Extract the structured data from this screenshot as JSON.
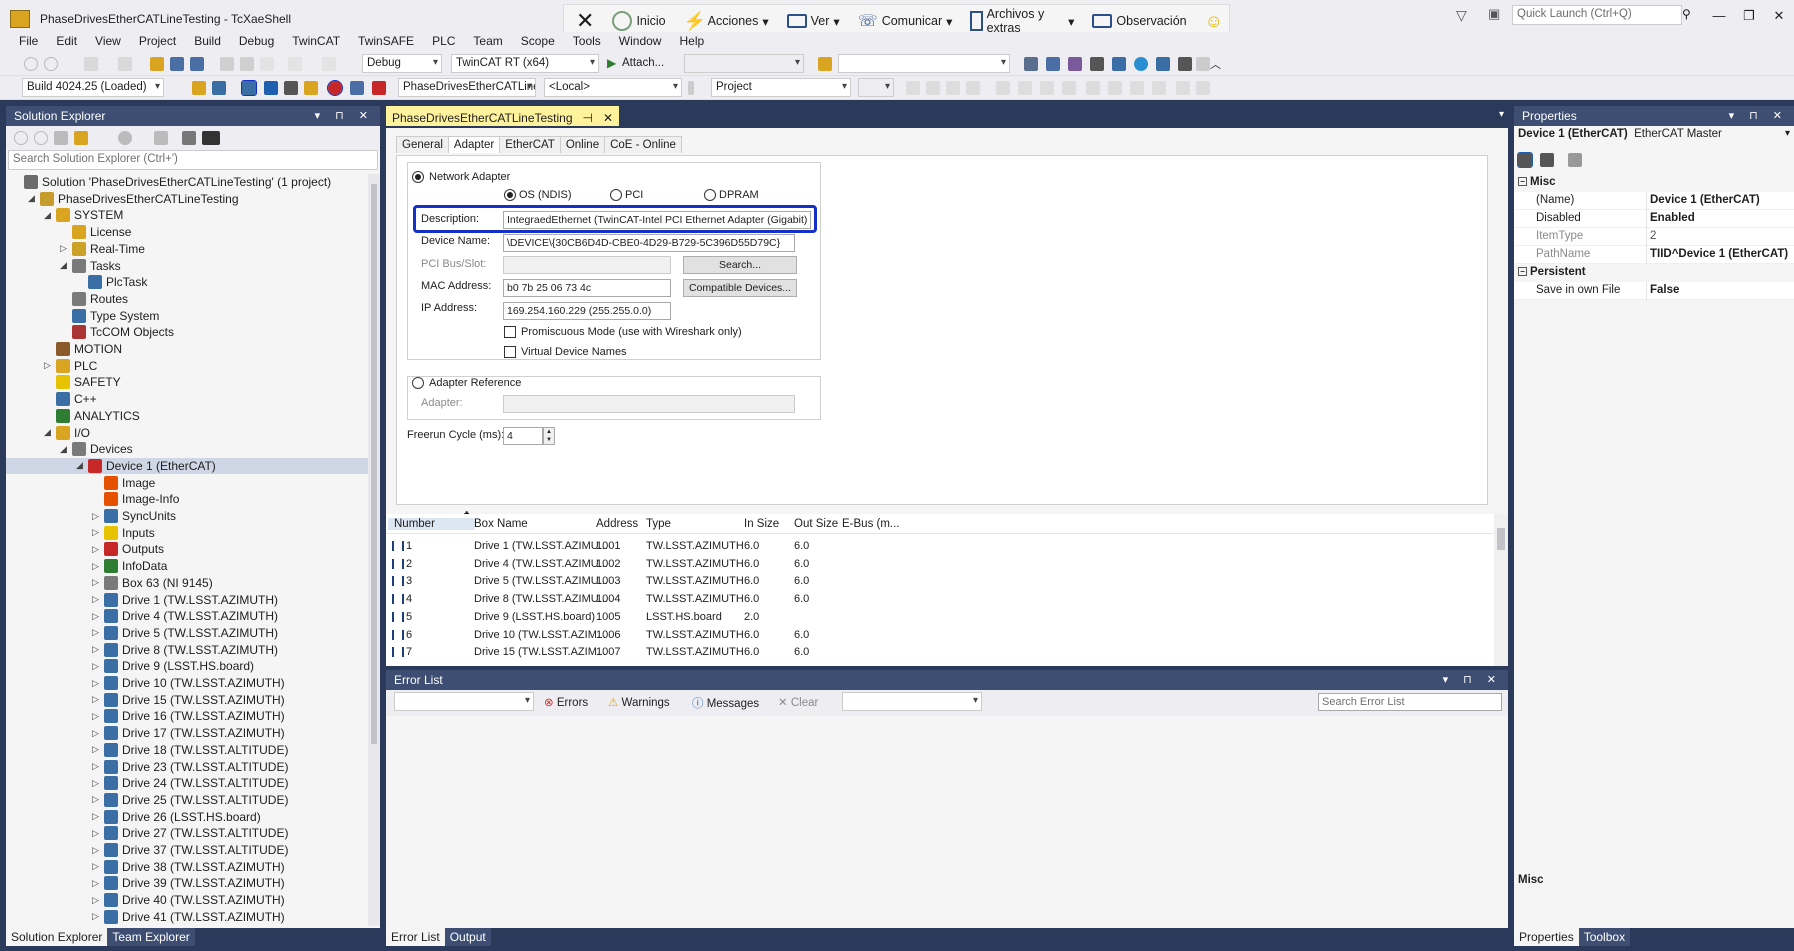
{
  "window": {
    "title": "PhaseDrivesEtherCATLineTesting - TcXaeShell",
    "quick_launch_placeholder": "Quick Launch (Ctrl+Q)"
  },
  "context_bar": {
    "items": [
      "Inicio",
      "Acciones",
      "Ver",
      "Comunicar",
      "Archivos y extras",
      "Observación"
    ]
  },
  "menu": [
    "File",
    "Edit",
    "View",
    "Project",
    "Build",
    "Debug",
    "TwinCAT",
    "TwinSAFE",
    "PLC",
    "Team",
    "Scope",
    "Tools",
    "Window",
    "Help"
  ],
  "toolbar1": {
    "config": "Debug",
    "platform": "TwinCAT RT (x64)",
    "attach": "Attach..."
  },
  "toolbar2": {
    "build": "Build 4024.25 (Loaded)",
    "project": "PhaseDrivesEtherCATLine",
    "target": "<Local>",
    "scope": "Project"
  },
  "solution_explorer": {
    "title": "Solution Explorer",
    "search_placeholder": "Search Solution Explorer (Ctrl+')",
    "tabs": [
      "Solution Explorer",
      "Team Explorer"
    ],
    "nodes": [
      {
        "label": "Solution 'PhaseDrivesEtherCATLineTesting' (1 project)",
        "level": 0,
        "arrow": "",
        "color": "#6b6b6b"
      },
      {
        "label": "PhaseDrivesEtherCATLineTesting",
        "level": 1,
        "arrow": "◢",
        "color": "#c69c2a"
      },
      {
        "label": "SYSTEM",
        "level": 2,
        "arrow": "◢",
        "color": "#d9a521"
      },
      {
        "label": "License",
        "level": 3,
        "arrow": "",
        "color": "#d9a521"
      },
      {
        "label": "Real-Time",
        "level": 3,
        "arrow": "▷",
        "color": "#c9a227"
      },
      {
        "label": "Tasks",
        "level": 3,
        "arrow": "◢",
        "color": "#7a7a7a"
      },
      {
        "label": "PlcTask",
        "level": 4,
        "arrow": "",
        "color": "#3a6ea5"
      },
      {
        "label": "Routes",
        "level": 3,
        "arrow": "",
        "color": "#7a7a7a"
      },
      {
        "label": "Type System",
        "level": 3,
        "arrow": "",
        "color": "#3a6ea5"
      },
      {
        "label": "TcCOM Objects",
        "level": 3,
        "arrow": "",
        "color": "#a33"
      },
      {
        "label": "MOTION",
        "level": 2,
        "arrow": "",
        "color": "#8a5a2a"
      },
      {
        "label": "PLC",
        "level": 2,
        "arrow": "▷",
        "color": "#d9a521"
      },
      {
        "label": "SAFETY",
        "level": 2,
        "arrow": "",
        "color": "#e6c200"
      },
      {
        "label": "C++",
        "level": 2,
        "arrow": "",
        "color": "#3a6ea5"
      },
      {
        "label": "ANALYTICS",
        "level": 2,
        "arrow": "",
        "color": "#2e7d32"
      },
      {
        "label": "I/O",
        "level": 2,
        "arrow": "◢",
        "color": "#d9a521"
      },
      {
        "label": "Devices",
        "level": 3,
        "arrow": "◢",
        "color": "#7a7a7a"
      },
      {
        "label": "Device 1 (EtherCAT)",
        "level": 4,
        "arrow": "◢",
        "color": "#c62828",
        "selected": true
      },
      {
        "label": "Image",
        "level": 5,
        "arrow": "",
        "color": "#e65100"
      },
      {
        "label": "Image-Info",
        "level": 5,
        "arrow": "",
        "color": "#e65100"
      },
      {
        "label": "SyncUnits",
        "level": 5,
        "arrow": "▷",
        "color": "#3a6ea5"
      },
      {
        "label": "Inputs",
        "level": 5,
        "arrow": "▷",
        "color": "#e6c200"
      },
      {
        "label": "Outputs",
        "level": 5,
        "arrow": "▷",
        "color": "#c62828"
      },
      {
        "label": "InfoData",
        "level": 5,
        "arrow": "▷",
        "color": "#2e7d32"
      },
      {
        "label": "Box 63 (NI 9145)",
        "level": 5,
        "arrow": "▷",
        "color": "#7a7a7a"
      },
      {
        "label": "Drive 1 (TW.LSST.AZIMUTH)",
        "level": 5,
        "arrow": "▷",
        "color": "#3a6ea5"
      },
      {
        "label": "Drive 4 (TW.LSST.AZIMUTH)",
        "level": 5,
        "arrow": "▷",
        "color": "#3a6ea5"
      },
      {
        "label": "Drive 5 (TW.LSST.AZIMUTH)",
        "level": 5,
        "arrow": "▷",
        "color": "#3a6ea5"
      },
      {
        "label": "Drive 8 (TW.LSST.AZIMUTH)",
        "level": 5,
        "arrow": "▷",
        "color": "#3a6ea5"
      },
      {
        "label": "Drive 9 (LSST.HS.board)",
        "level": 5,
        "arrow": "▷",
        "color": "#3a6ea5"
      },
      {
        "label": "Drive 10 (TW.LSST.AZIMUTH)",
        "level": 5,
        "arrow": "▷",
        "color": "#3a6ea5"
      },
      {
        "label": "Drive 15 (TW.LSST.AZIMUTH)",
        "level": 5,
        "arrow": "▷",
        "color": "#3a6ea5"
      },
      {
        "label": "Drive 16 (TW.LSST.AZIMUTH)",
        "level": 5,
        "arrow": "▷",
        "color": "#3a6ea5"
      },
      {
        "label": "Drive 17 (TW.LSST.AZIMUTH)",
        "level": 5,
        "arrow": "▷",
        "color": "#3a6ea5"
      },
      {
        "label": "Drive 18 (TW.LSST.ALTITUDE)",
        "level": 5,
        "arrow": "▷",
        "color": "#3a6ea5"
      },
      {
        "label": "Drive 23 (TW.LSST.ALTITUDE)",
        "level": 5,
        "arrow": "▷",
        "color": "#3a6ea5"
      },
      {
        "label": "Drive 24 (TW.LSST.ALTITUDE)",
        "level": 5,
        "arrow": "▷",
        "color": "#3a6ea5"
      },
      {
        "label": "Drive 25 (TW.LSST.ALTITUDE)",
        "level": 5,
        "arrow": "▷",
        "color": "#3a6ea5"
      },
      {
        "label": "Drive 26 (LSST.HS.board)",
        "level": 5,
        "arrow": "▷",
        "color": "#3a6ea5"
      },
      {
        "label": "Drive 27 (TW.LSST.ALTITUDE)",
        "level": 5,
        "arrow": "▷",
        "color": "#3a6ea5"
      },
      {
        "label": "Drive 37 (TW.LSST.ALTITUDE)",
        "level": 5,
        "arrow": "▷",
        "color": "#3a6ea5"
      },
      {
        "label": "Drive 38 (TW.LSST.AZIMUTH)",
        "level": 5,
        "arrow": "▷",
        "color": "#3a6ea5"
      },
      {
        "label": "Drive 39 (TW.LSST.AZIMUTH)",
        "level": 5,
        "arrow": "▷",
        "color": "#3a6ea5"
      },
      {
        "label": "Drive 40 (TW.LSST.AZIMUTH)",
        "level": 5,
        "arrow": "▷",
        "color": "#3a6ea5"
      },
      {
        "label": "Drive 41 (TW.LSST.AZIMUTH)",
        "level": 5,
        "arrow": "▷",
        "color": "#3a6ea5"
      }
    ]
  },
  "editor": {
    "doc_tab": "PhaseDrivesEtherCATLineTesting",
    "prop_tabs": [
      "General",
      "Adapter",
      "EtherCAT",
      "Online",
      "CoE - Online"
    ],
    "active_tab": "Adapter",
    "network_adapter": "Network Adapter",
    "radio_os": "OS (NDIS)",
    "radio_pci": "PCI",
    "radio_dpram": "DPRAM",
    "description_label": "Description:",
    "description_value": "IntegraedEthernet (TwinCAT-Intel PCI Ethernet Adapter (Gigabit) \\",
    "device_name_label": "Device Name:",
    "device_name_value": "\\DEVICE\\{30CB6D4D-CBE0-4D29-B729-5C396D55D79C}",
    "pci_label": "PCI Bus/Slot:",
    "pci_value": "",
    "search_btn": "Search...",
    "mac_label": "MAC Address:",
    "mac_value": "b0 7b 25 06 73 4c",
    "compatible_btn": "Compatible Devices...",
    "ip_label": "IP Address:",
    "ip_value": "169.254.160.229 (255.255.0.0)",
    "promiscuous": "Promiscuous Mode (use with Wireshark only)",
    "virtual_names": "Virtual Device Names",
    "adapter_reference": "Adapter Reference",
    "adapter_label": "Adapter:",
    "freerun_label": "Freerun Cycle (ms):",
    "freerun_value": "4"
  },
  "box_grid": {
    "headers": [
      "Number",
      "Box Name",
      "Address",
      "Type",
      "In Size",
      "Out Size",
      "E-Bus (m..."
    ],
    "rows": [
      [
        "1",
        "Drive 1 (TW.LSST.AZIMU...",
        "1001",
        "TW.LSST.AZIMUTH",
        "6.0",
        "6.0",
        ""
      ],
      [
        "2",
        "Drive 4 (TW.LSST.AZIMU...",
        "1002",
        "TW.LSST.AZIMUTH",
        "6.0",
        "6.0",
        ""
      ],
      [
        "3",
        "Drive 5 (TW.LSST.AZIMU...",
        "1003",
        "TW.LSST.AZIMUTH",
        "6.0",
        "6.0",
        ""
      ],
      [
        "4",
        "Drive 8 (TW.LSST.AZIMU...",
        "1004",
        "TW.LSST.AZIMUTH",
        "6.0",
        "6.0",
        ""
      ],
      [
        "5",
        "Drive 9 (LSST.HS.board)",
        "1005",
        "LSST.HS.board",
        "2.0",
        "",
        ""
      ],
      [
        "6",
        "Drive 10 (TW.LSST.AZIM...",
        "1006",
        "TW.LSST.AZIMUTH",
        "6.0",
        "6.0",
        ""
      ],
      [
        "7",
        "Drive 15 (TW.LSST.AZIM...",
        "1007",
        "TW.LSST.AZIMUTH",
        "6.0",
        "6.0",
        ""
      ]
    ]
  },
  "error_list": {
    "title": "Error List",
    "errors": "Errors",
    "warnings": "Warnings",
    "messages": "Messages",
    "clear": "Clear",
    "search_placeholder": "Search Error List",
    "tabs": [
      "Error List",
      "Output"
    ]
  },
  "properties": {
    "title": "Properties",
    "object": "Device 1 (EtherCAT)",
    "object_type": "EtherCAT Master",
    "categories": [
      {
        "name": "Misc",
        "rows": [
          {
            "key": "(Name)",
            "value": "Device 1 (EtherCAT)"
          },
          {
            "key": "Disabled",
            "value": "Enabled"
          },
          {
            "key": "ItemType",
            "value": "2"
          },
          {
            "key": "PathName",
            "value": "TIID^Device 1 (EtherCAT)"
          }
        ]
      },
      {
        "name": "Persistent",
        "rows": [
          {
            "key": "Save in own File",
            "value": "False"
          }
        ]
      }
    ],
    "description_title": "Misc",
    "tabs": [
      "Properties",
      "Toolbox"
    ]
  }
}
